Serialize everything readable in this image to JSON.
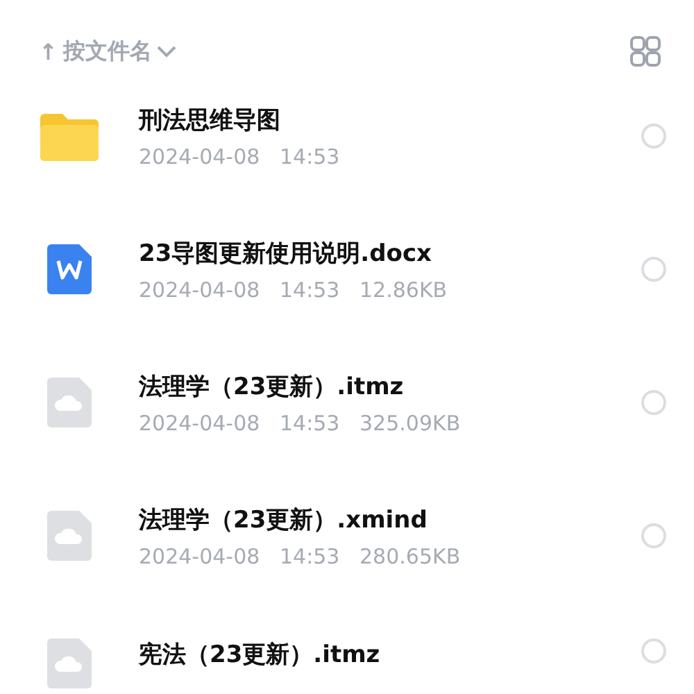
{
  "sort_bar": {
    "arrow": "↑",
    "label": "按文件名"
  },
  "files": [
    {
      "kind": "folder",
      "name": "刑法思维导图",
      "date": "2024-04-08",
      "time": "14:53",
      "selected": false
    },
    {
      "kind": "word",
      "name": "23导图更新使用说明.docx",
      "date": "2024-04-08",
      "time": "14:53",
      "size": "12.86KB",
      "selected": false
    },
    {
      "kind": "cloud",
      "name": "法理学（23更新）.itmz",
      "date": "2024-04-08",
      "time": "14:53",
      "size": "325.09KB",
      "selected": false
    },
    {
      "kind": "cloud",
      "name": "法理学（23更新）.xmind",
      "date": "2024-04-08",
      "time": "14:53",
      "size": "280.65KB",
      "selected": false
    },
    {
      "kind": "cloud",
      "name": "宪法（23更新）.itmz",
      "selected": false
    }
  ]
}
